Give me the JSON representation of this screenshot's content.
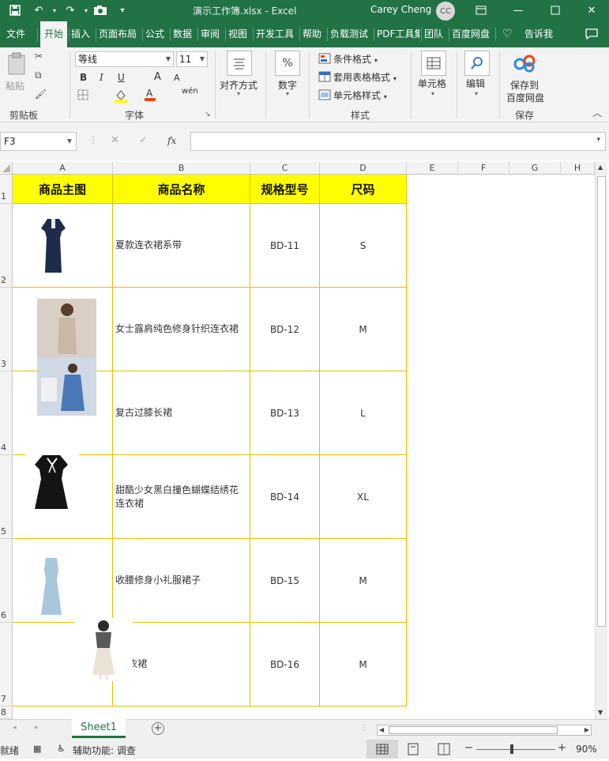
{
  "window": {
    "title": "演示工作簿.xlsx  -  Excel",
    "user": "Carey Cheng",
    "user_initials": "CC"
  },
  "ribbon_tabs": [
    "文件",
    "开始",
    "插入",
    "页面布局",
    "公式",
    "数据",
    "审阅",
    "视图",
    "开发工具",
    "帮助",
    "负载测试",
    "PDF工具集",
    "团队",
    "百度网盘"
  ],
  "active_tab": "开始",
  "tell_me": "告诉我",
  "ribbon": {
    "clipboard": {
      "paste": "粘贴",
      "label": "剪贴板"
    },
    "font": {
      "name": "等线",
      "size": "11",
      "label": "字体",
      "bold": "B",
      "italic": "I",
      "underline": "U",
      "grow": "A",
      "shrink": "A",
      "wen": "wén"
    },
    "align": {
      "label": "对齐方式"
    },
    "number": {
      "label": "数字",
      "icon": "%"
    },
    "styles": {
      "cond": "条件格式",
      "table": "套用表格格式",
      "cell": "单元格样式",
      "label": "样式"
    },
    "cells": {
      "label": "单元格"
    },
    "editing": {
      "label": "编辑"
    },
    "save": {
      "line1": "保存到",
      "line2": "百度网盘",
      "label": "保存"
    }
  },
  "formula_bar": {
    "name_box": "F3",
    "fx": "fx",
    "formula": ""
  },
  "columns": [
    "A",
    "B",
    "C",
    "D",
    "E",
    "F",
    "G",
    "H"
  ],
  "rows": [
    "1",
    "2",
    "3",
    "4",
    "5",
    "6",
    "7",
    "8"
  ],
  "table": {
    "headers": [
      "商品主图",
      "商品名称",
      "规格型号",
      "尺码"
    ],
    "rows": [
      {
        "name": "夏款连衣裙系带",
        "spec": "BD-11",
        "size": "S"
      },
      {
        "name": "女士露肩纯色修身针织连衣裙",
        "spec": "BD-12",
        "size": "M"
      },
      {
        "name": "复古过膝长裙",
        "spec": "BD-13",
        "size": "L"
      },
      {
        "name": "甜酷少女黑白撞色蝴蝶结绣花连衣裙",
        "spec": "BD-14",
        "size": "XL"
      },
      {
        "name": "收腰修身小礼服裙子",
        "spec": "BD-15",
        "size": "M"
      },
      {
        "name": "f连衣裙",
        "spec": "BD-16",
        "size": "M"
      }
    ]
  },
  "sheet_tab": "Sheet1",
  "status": {
    "ready": "就绪",
    "accessibility": "辅助功能: 调查",
    "zoom": "90%"
  }
}
